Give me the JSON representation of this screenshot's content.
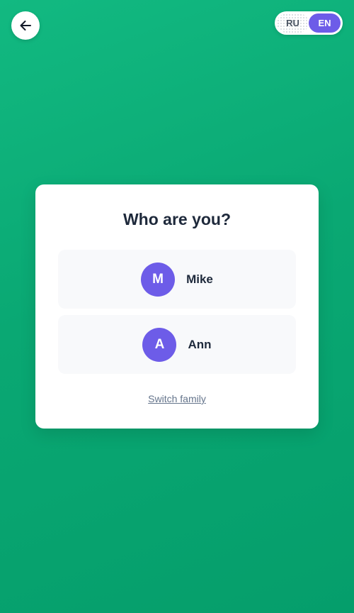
{
  "header": {
    "back_icon": "arrow-left-icon",
    "languages": [
      {
        "code": "RU",
        "active": false
      },
      {
        "code": "EN",
        "active": true
      }
    ]
  },
  "card": {
    "title": "Who are you?",
    "profiles": [
      {
        "initial": "M",
        "name": "Mike"
      },
      {
        "initial": "A",
        "name": "Ann"
      }
    ],
    "switch_family": "Switch family"
  },
  "colors": {
    "background_start": "#12b981",
    "background_end": "#059e6b",
    "accent": "#6d5ce8",
    "text_primary": "#1e293b",
    "text_muted": "#64748b"
  }
}
